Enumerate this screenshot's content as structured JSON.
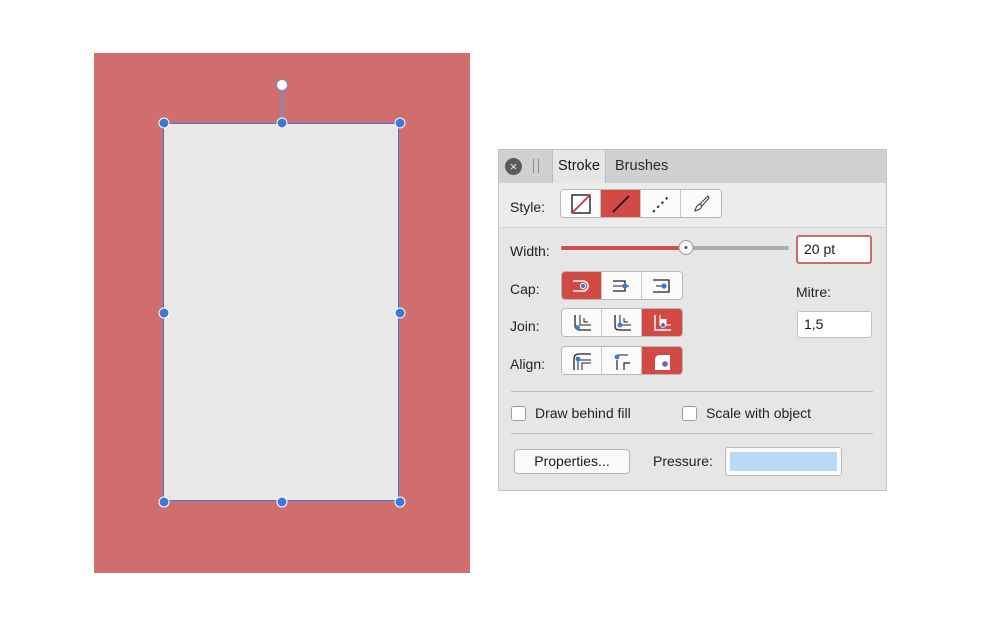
{
  "panel": {
    "tabs": [
      "Stroke",
      "Brushes"
    ],
    "active_tab": "Stroke",
    "style": {
      "label": "Style:",
      "options": [
        "no-stroke",
        "solid-line",
        "dashed-line",
        "texture-brush"
      ],
      "selected": "solid-line"
    },
    "width": {
      "label": "Width:",
      "value": "20 pt",
      "slider_fraction": 0.55
    },
    "cap": {
      "label": "Cap:",
      "options": [
        "butt-cap",
        "round-cap",
        "square-cap"
      ],
      "selected": "butt-cap"
    },
    "join": {
      "label": "Join:",
      "options": [
        "mitre-join",
        "round-join",
        "bevel-join"
      ],
      "selected": "bevel-join"
    },
    "align": {
      "label": "Align:",
      "options": [
        "align-inside",
        "align-center",
        "align-outside"
      ],
      "selected": "align-outside"
    },
    "mitre": {
      "label": "Mitre:",
      "value": "1,5"
    },
    "draw_behind_fill": {
      "label": "Draw behind fill",
      "checked": false
    },
    "scale_with_object": {
      "label": "Scale with object",
      "checked": false
    },
    "properties_button": "Properties...",
    "pressure": {
      "label": "Pressure:",
      "color": "#bcd8f7"
    }
  },
  "canvas": {
    "background_color": "#d06e6e",
    "shape_fill": "#e9e8e8",
    "selection_color": "#3b78d8"
  },
  "accent_color": "#d34a45"
}
